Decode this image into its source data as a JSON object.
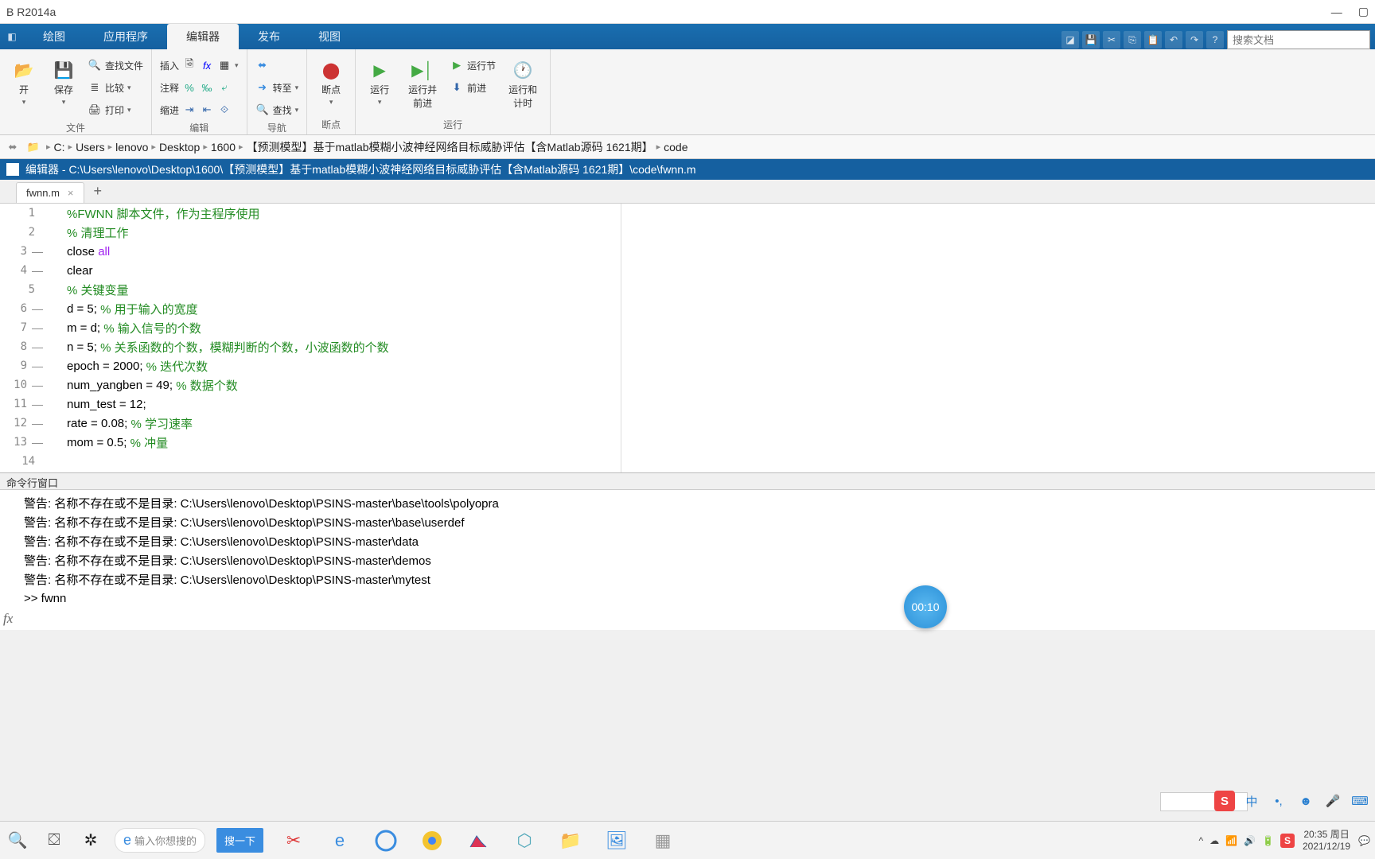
{
  "window": {
    "title": "B R2014a"
  },
  "ribbon": {
    "tabs": [
      "绘图",
      "应用程序",
      "编辑器",
      "发布",
      "视图"
    ],
    "active_tab": 2,
    "search_placeholder": "搜索文档",
    "groups": {
      "file": {
        "label": "文件",
        "open": "开",
        "save": "保存",
        "find_files": "查找文件",
        "compare": "比较",
        "print": "打印"
      },
      "edit": {
        "label": "编辑",
        "insert": "插入",
        "comment": "注释",
        "indent": "缩进",
        "fx": "fx"
      },
      "nav": {
        "label": "导航",
        "goto": "转至",
        "find": "查找"
      },
      "breakpoints": {
        "label": "断点",
        "breakpoint": "断点"
      },
      "run": {
        "label": "运行",
        "run": "运行",
        "run_advance": "运行并\n前进",
        "run_section": "运行节",
        "advance": "前进",
        "run_time": "运行和\n计时"
      }
    }
  },
  "breadcrumb": [
    "C:",
    "Users",
    "lenovo",
    "Desktop",
    "1600",
    "【预测模型】基于matlab模糊小波神经网络目标威胁评估【含Matlab源码 1621期】",
    "code"
  ],
  "editor": {
    "title": "编辑器 - C:\\Users\\lenovo\\Desktop\\1600\\【预测模型】基于matlab模糊小波神经网络目标威胁评估【含Matlab源码 1621期】\\code\\fwnn.m",
    "tab_name": "fwnn.m",
    "lines": [
      {
        "n": 1,
        "dash": false,
        "segs": [
          {
            "c": "comment",
            "t": "%FWNN 脚本文件，作为主程序使用"
          }
        ]
      },
      {
        "n": 2,
        "dash": false,
        "segs": [
          {
            "c": "comment",
            "t": "% 清理工作"
          }
        ]
      },
      {
        "n": 3,
        "dash": true,
        "segs": [
          {
            "c": "normal",
            "t": "close "
          },
          {
            "c": "string",
            "t": "all"
          }
        ]
      },
      {
        "n": 4,
        "dash": true,
        "segs": [
          {
            "c": "normal",
            "t": "clear"
          }
        ]
      },
      {
        "n": 5,
        "dash": false,
        "segs": [
          {
            "c": "comment",
            "t": "% 关键变量"
          }
        ]
      },
      {
        "n": 6,
        "dash": true,
        "segs": [
          {
            "c": "normal",
            "t": "d = 5; "
          },
          {
            "c": "comment",
            "t": "% 用于输入的宽度"
          }
        ]
      },
      {
        "n": 7,
        "dash": true,
        "segs": [
          {
            "c": "normal",
            "t": "m = d; "
          },
          {
            "c": "comment",
            "t": "% 输入信号的个数"
          }
        ]
      },
      {
        "n": 8,
        "dash": true,
        "segs": [
          {
            "c": "normal",
            "t": "n = 5; "
          },
          {
            "c": "comment",
            "t": "% 关系函数的个数，模糊判断的个数，小波函数的个数"
          }
        ]
      },
      {
        "n": 9,
        "dash": true,
        "segs": [
          {
            "c": "normal",
            "t": "epoch = 2000; "
          },
          {
            "c": "comment",
            "t": "% 迭代次数"
          }
        ]
      },
      {
        "n": 10,
        "dash": true,
        "segs": [
          {
            "c": "normal",
            "t": "num_yangben = 49; "
          },
          {
            "c": "comment",
            "t": "% 数据个数"
          }
        ]
      },
      {
        "n": 11,
        "dash": true,
        "segs": [
          {
            "c": "normal",
            "t": "num_test = 12;"
          }
        ]
      },
      {
        "n": 12,
        "dash": true,
        "segs": [
          {
            "c": "normal",
            "t": "rate = 0.08; "
          },
          {
            "c": "comment",
            "t": "% 学习速率"
          }
        ]
      },
      {
        "n": 13,
        "dash": true,
        "segs": [
          {
            "c": "normal",
            "t": "mom = 0.5; "
          },
          {
            "c": "comment",
            "t": "% 冲量"
          }
        ]
      },
      {
        "n": 14,
        "dash": false,
        "segs": []
      }
    ]
  },
  "cmd": {
    "title": "命令行窗口",
    "lines": [
      "警告: 名称不存在或不是目录: C:\\Users\\lenovo\\Desktop\\PSINS-master\\base\\tools\\polyopra",
      "警告: 名称不存在或不是目录: C:\\Users\\lenovo\\Desktop\\PSINS-master\\base\\userdef",
      "警告: 名称不存在或不是目录: C:\\Users\\lenovo\\Desktop\\PSINS-master\\data",
      "警告: 名称不存在或不是目录: C:\\Users\\lenovo\\Desktop\\PSINS-master\\demos",
      "警告: 名称不存在或不是目录: C:\\Users\\lenovo\\Desktop\\PSINS-master\\mytest",
      ">> fwnn"
    ],
    "fx": "fx"
  },
  "timer": "00:10",
  "ime": {
    "s": "S",
    "zhong": "中"
  },
  "taskbar": {
    "search_placeholder": "输入你想搜的",
    "search_button": "搜一下",
    "time": "20:35 周日",
    "date": "2021/12/19"
  }
}
